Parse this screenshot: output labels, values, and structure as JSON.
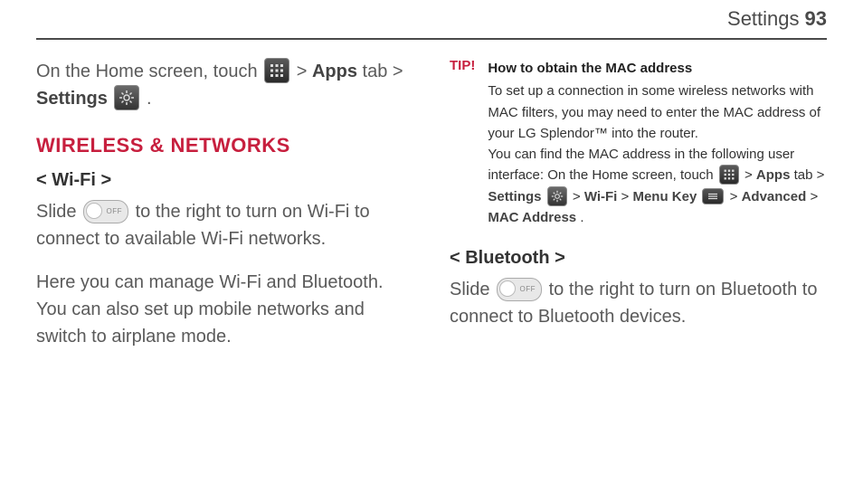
{
  "header": {
    "title": "Settings",
    "page": "93"
  },
  "left": {
    "intro_1": "On the Home screen, touch ",
    "intro_gt1": " > ",
    "intro_apps": "Apps",
    "intro_tab": " tab > ",
    "intro_settings": "Settings",
    "intro_dot": ".",
    "section": "WIRELESS & NETWORKS",
    "wifi_heading": "< Wi-Fi >",
    "wifi_p1a": "Slide ",
    "wifi_p1b": " to the right to turn on Wi-Fi to connect to available Wi-Fi networks.",
    "wifi_p2": "Here you can manage Wi-Fi and Bluetooth. You can also set up mobile networks and switch to airplane mode."
  },
  "tip": {
    "label": "TIP!",
    "title": "How to obtain the MAC address",
    "body1": "To set up a connection in some wireless networks with MAC filters, you may need to enter the MAC address of your LG Splendor™ into the router.",
    "body2a": "You can find the MAC address in the following user interface: On the Home screen, touch ",
    "gt1": " > ",
    "apps": "Apps",
    "tab": " tab > ",
    "settings": "Settings",
    "gt2": " > ",
    "wifi": "Wi-Fi",
    "gt3": " > ",
    "menukey": "Menu Key",
    "gt4": " > ",
    "advanced": "Advanced",
    "gt5": " > ",
    "mac": "MAC Address",
    "dot": "."
  },
  "right": {
    "bt_heading": "< Bluetooth >",
    "bt_p1a": "Slide ",
    "bt_p1b": " to the right to turn on Bluetooth to connect to Bluetooth devices."
  }
}
